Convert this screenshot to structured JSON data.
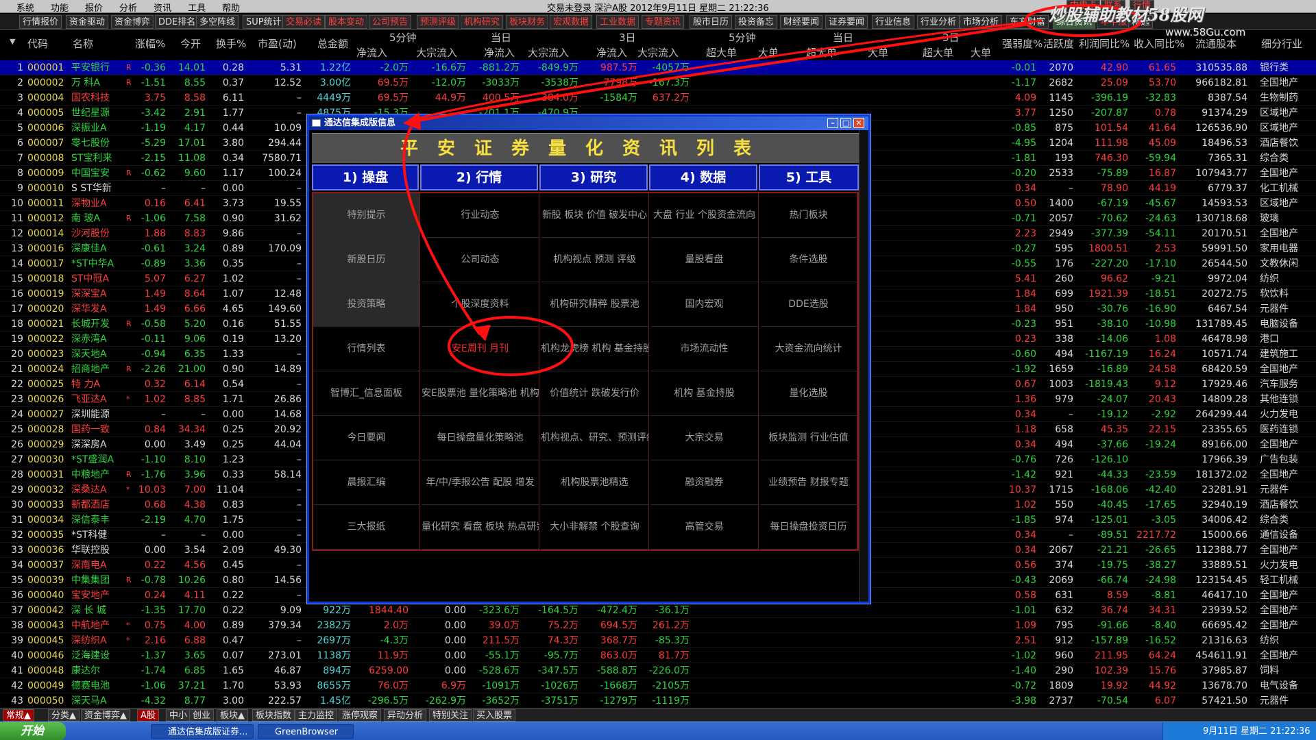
{
  "menu": {
    "items": [
      "系统",
      "功能",
      "报价",
      "分析",
      "资讯",
      "工具",
      "帮助"
    ],
    "status": "交易未登录    深沪A股    2012年9月11日  星期二  21:22:36",
    "right_buttons": [
      "内电卡",
      "联系",
      "行情"
    ]
  },
  "watermark": {
    "title": "炒股辅助教材58股网",
    "url": "www.58Gu.com"
  },
  "top_tabs": [
    {
      "label": "行情报价",
      "tone": "white"
    },
    {
      "label": "资金驱动",
      "tone": "white"
    },
    {
      "label": "资金博弈",
      "tone": "white"
    },
    {
      "label": "DDE排名",
      "tone": "white"
    },
    {
      "label": "多空阵线",
      "tone": "white"
    },
    {
      "label": "SUP统计",
      "tone": "white"
    },
    {
      "label": "交易必读",
      "tone": "red"
    },
    {
      "label": "股本变动",
      "tone": "red"
    },
    {
      "label": "公司预告",
      "tone": "red"
    },
    {
      "label": "预测评级",
      "tone": "red"
    },
    {
      "label": "机构研究",
      "tone": "red"
    },
    {
      "label": "板块财务",
      "tone": "red"
    },
    {
      "label": "宏观数据",
      "tone": "red"
    },
    {
      "label": "工业数据",
      "tone": "red"
    },
    {
      "label": "专题资讯",
      "tone": "red"
    },
    {
      "label": "股市日历",
      "tone": "white"
    },
    {
      "label": "投资备忘",
      "tone": "white"
    },
    {
      "label": "财经要闻",
      "tone": "white"
    },
    {
      "label": "证券要闻",
      "tone": "white"
    },
    {
      "label": "行业信息",
      "tone": "white"
    },
    {
      "label": "行业分析",
      "tone": "white"
    },
    {
      "label": "市场分析",
      "tone": "white"
    },
    {
      "label": "东方财富",
      "tone": "white"
    },
    {
      "label": "综合资讯",
      "tone": "active"
    },
    {
      "label": "年中报",
      "tone": "red"
    },
    {
      "label": "精选",
      "tone": "white"
    }
  ],
  "table": {
    "group_headers": [
      "5分钟",
      "当日",
      "3日",
      "5分钟",
      "当日",
      "3日"
    ],
    "headers": [
      "代码",
      "名称",
      "涨幅%",
      "今开",
      "换手%",
      "市盈(动)",
      "总金额",
      "净流入",
      "大宗流入",
      "净流入",
      "大宗流入",
      "净流入",
      "大宗流入",
      "超大单",
      "大单",
      "超大单",
      "大单",
      "超大单",
      "大单",
      "强弱度%",
      "活跃度",
      "利润同比%",
      "收入同比%",
      "流通股本",
      "细分行业"
    ],
    "rows": [
      [
        "1",
        "000001",
        "平安银行",
        "R",
        "-0.36",
        "14.01",
        "0.28",
        "5.31",
        "1.22亿",
        "-2.0万",
        "-16.6万",
        "-881.2万",
        "-849.9万",
        "987.5万",
        "-4057万",
        "-0.01",
        "2070",
        "42.90",
        "61.65",
        "310535.88",
        "银行类"
      ],
      [
        "2",
        "000002",
        "万  科A",
        "R",
        "-1.51",
        "8.55",
        "0.37",
        "12.52",
        "3.00亿",
        "69.5万",
        "-12.0万",
        "-3033万",
        "-3538万",
        "7798万",
        "-167.3万",
        "-1.17",
        "2682",
        "25.09",
        "53.70",
        "966182.81",
        "全国地产"
      ],
      [
        "3",
        "000004",
        "国农科技",
        "",
        "3.75",
        "8.58",
        "6.11",
        "–",
        "4449万",
        "69.5万",
        "44.9万",
        "400.5万",
        "384.0万",
        "-1584万",
        "637.2万",
        "4.09",
        "1145",
        "-396.19",
        "-32.83",
        "8387.54",
        "生物制药"
      ],
      [
        "4",
        "000005",
        "世纪星源",
        "",
        "-3.42",
        "2.91",
        "1.77",
        "–",
        "4875万",
        "-15.3万",
        "",
        "-201.1万",
        "-470.9万",
        "",
        "",
        "3.77",
        "1250",
        "-207.87",
        "0.78",
        "91374.29",
        "区域地产"
      ],
      [
        "5",
        "000006",
        "深振业A",
        "",
        "-1.19",
        "4.17",
        "0.44",
        "10.09",
        "",
        "",
        "",
        "",
        "",
        "",
        "",
        "-0.85",
        "875",
        "101.54",
        "41.64",
        "126536.90",
        "区域地产"
      ],
      [
        "6",
        "000007",
        "零七股份",
        "",
        "-5.29",
        "17.01",
        "3.80",
        "294.44",
        "",
        "",
        "",
        "",
        "",
        "",
        "",
        "-4.95",
        "1204",
        "111.98",
        "45.09",
        "18496.53",
        "酒店餐饮"
      ],
      [
        "7",
        "000008",
        "ST宝利来",
        "",
        "-2.15",
        "11.08",
        "0.34",
        "7580.71",
        "",
        "",
        "",
        "",
        "",
        "",
        "",
        "-1.81",
        "193",
        "746.30",
        "-59.94",
        "7365.31",
        "综合类"
      ],
      [
        "8",
        "000009",
        "中国宝安",
        "R",
        "-0.62",
        "9.60",
        "1.17",
        "100.24",
        "",
        "",
        "",
        "",
        "",
        "",
        "",
        "-0.20",
        "2533",
        "-75.89",
        "16.87",
        "107943.77",
        "全国地产"
      ],
      [
        "9",
        "000010",
        "S ST华新",
        "",
        "–",
        "–",
        "0.00",
        "–",
        "",
        "",
        "",
        "",
        "",
        "",
        "",
        "0.34",
        "–",
        "78.90",
        "44.19",
        "6779.37",
        "化工机械"
      ],
      [
        "10",
        "000011",
        "深物业A",
        "",
        "0.16",
        "6.41",
        "3.73",
        "19.55",
        "",
        "",
        "",
        "",
        "",
        "",
        "",
        "0.50",
        "1400",
        "-67.19",
        "-45.67",
        "14593.53",
        "区域地产"
      ],
      [
        "11",
        "000012",
        "南  玻A",
        "R",
        "-1.06",
        "7.58",
        "0.90",
        "31.62",
        "",
        "",
        "",
        "",
        "",
        "",
        "",
        "-0.71",
        "2057",
        "-70.62",
        "-24.63",
        "130718.68",
        "玻璃"
      ],
      [
        "12",
        "000014",
        "沙河股份",
        "",
        "1.88",
        "8.83",
        "9.86",
        "–",
        "",
        "",
        "",
        "",
        "",
        "",
        "",
        "2.23",
        "2949",
        "-377.39",
        "-54.11",
        "20170.51",
        "全国地产"
      ],
      [
        "13",
        "000016",
        "深康佳A",
        "",
        "-0.61",
        "3.24",
        "0.89",
        "170.09",
        "",
        "",
        "",
        "",
        "",
        "",
        "",
        "-0.27",
        "595",
        "1800.51",
        "2.53",
        "59991.50",
        "家用电器"
      ],
      [
        "14",
        "000017",
        "*ST中华A",
        "",
        "-0.89",
        "3.36",
        "0.35",
        "–",
        "",
        "",
        "",
        "",
        "",
        "",
        "",
        "-0.55",
        "176",
        "-227.20",
        "-17.10",
        "26544.50",
        "文教休闲"
      ],
      [
        "15",
        "000018",
        "ST中冠A",
        "",
        "5.07",
        "6.27",
        "1.02",
        "–",
        "",
        "",
        "",
        "",
        "",
        "",
        "",
        "5.41",
        "260",
        "96.62",
        "-9.21",
        "9972.04",
        "纺织"
      ],
      [
        "16",
        "000019",
        "深深宝A",
        "",
        "1.49",
        "8.64",
        "1.07",
        "12.48",
        "",
        "",
        "",
        "",
        "",
        "",
        "",
        "1.84",
        "699",
        "1921.39",
        "-18.51",
        "20272.75",
        "软饮料"
      ],
      [
        "17",
        "000020",
        "深华发A",
        "",
        "1.49",
        "6.66",
        "4.65",
        "149.60",
        "",
        "",
        "",
        "",
        "",
        "",
        "",
        "1.84",
        "950",
        "-30.76",
        "-16.90",
        "6467.54",
        "元器件"
      ],
      [
        "18",
        "000021",
        "长城开发",
        "R",
        "-0.58",
        "5.20",
        "0.16",
        "51.55",
        "",
        "",
        "",
        "",
        "",
        "",
        "",
        "-0.23",
        "951",
        "-38.10",
        "-10.98",
        "131789.45",
        "电脑设备"
      ],
      [
        "19",
        "000022",
        "深赤湾A",
        "",
        "-0.11",
        "9.06",
        "0.19",
        "13.20",
        "",
        "",
        "",
        "",
        "",
        "",
        "",
        "0.23",
        "338",
        "-14.06",
        "1.08",
        "46478.98",
        "港口"
      ],
      [
        "20",
        "000023",
        "深天地A",
        "",
        "-0.94",
        "6.35",
        "1.33",
        "–",
        "",
        "",
        "",
        "",
        "",
        "",
        "",
        "-0.60",
        "494",
        "-1167.19",
        "16.24",
        "10571.74",
        "建筑施工"
      ],
      [
        "21",
        "000024",
        "招商地产",
        "R",
        "-2.26",
        "21.00",
        "0.90",
        "14.89",
        "",
        "",
        "",
        "",
        "",
        "",
        "",
        "-1.92",
        "1659",
        "-16.89",
        "24.58",
        "68420.59",
        "全国地产"
      ],
      [
        "22",
        "000025",
        "特  力A",
        "",
        "0.32",
        "6.14",
        "0.54",
        "–",
        "",
        "",
        "",
        "",
        "",
        "",
        "",
        "0.67",
        "1003",
        "-1819.43",
        "9.12",
        "17929.46",
        "汽车服务"
      ],
      [
        "23",
        "000026",
        "飞亚达A",
        "*",
        "1.02",
        "8.85",
        "1.71",
        "26.86",
        "",
        "",
        "",
        "",
        "",
        "",
        "",
        "1.36",
        "979",
        "-24.07",
        "20.43",
        "14809.28",
        "其他连锁"
      ],
      [
        "24",
        "000027",
        "深圳能源",
        "",
        "–",
        "–",
        "0.00",
        "14.68",
        "",
        "",
        "",
        "",
        "",
        "",
        "",
        "0.34",
        "–",
        "-19.12",
        "-2.92",
        "264299.44",
        "火力发电"
      ],
      [
        "25",
        "000028",
        "国药一致",
        "",
        "0.84",
        "34.34",
        "0.25",
        "20.92",
        "",
        "",
        "",
        "",
        "",
        "",
        "",
        "1.18",
        "658",
        "45.35",
        "22.15",
        "23355.65",
        "医药连锁"
      ],
      [
        "26",
        "000029",
        "深深房A",
        "",
        "0.00",
        "3.49",
        "0.25",
        "44.04",
        "",
        "",
        "",
        "",
        "",
        "",
        "",
        "0.34",
        "494",
        "-37.66",
        "-19.24",
        "89166.00",
        "全国地产"
      ],
      [
        "27",
        "000030",
        "*ST盛润A",
        "",
        "-1.10",
        "8.10",
        "1.23",
        "–",
        "",
        "",
        "",
        "",
        "",
        "",
        "",
        "-0.76",
        "726",
        "-126.10",
        "",
        "17966.39",
        "广告包装"
      ],
      [
        "28",
        "000031",
        "中粮地产",
        "R",
        "-1.76",
        "3.96",
        "0.33",
        "58.14",
        "",
        "",
        "",
        "",
        "",
        "",
        "",
        "-1.42",
        "921",
        "-44.33",
        "-23.59",
        "181372.02",
        "全国地产"
      ],
      [
        "29",
        "000032",
        "深桑达A",
        "*",
        "10.03",
        "7.00",
        "11.04",
        "–",
        "",
        "",
        "",
        "",
        "",
        "",
        "",
        "10.37",
        "1715",
        "-168.06",
        "-42.40",
        "23281.91",
        "元器件"
      ],
      [
        "30",
        "000033",
        "新都酒店",
        "",
        "0.68",
        "4.38",
        "0.83",
        "–",
        "",
        "",
        "",
        "",
        "",
        "",
        "",
        "1.02",
        "550",
        "-40.45",
        "-17.65",
        "32940.19",
        "酒店餐饮"
      ],
      [
        "31",
        "000034",
        "深信泰丰",
        "",
        "-2.19",
        "4.70",
        "1.75",
        "–",
        "",
        "",
        "",
        "",
        "",
        "",
        "",
        "-1.85",
        "974",
        "-125.01",
        "-3.05",
        "34006.42",
        "综合类"
      ],
      [
        "32",
        "000035",
        "*ST科健",
        "",
        "–",
        "–",
        "0.00",
        "–",
        "",
        "",
        "",
        "",
        "",
        "",
        "",
        "0.34",
        "–",
        "-89.51",
        "2217.72",
        "15000.66",
        "通信设备"
      ],
      [
        "33",
        "000036",
        "华联控股",
        "",
        "0.00",
        "3.54",
        "2.09",
        "49.30",
        "",
        "",
        "",
        "",
        "",
        "",
        "",
        "0.34",
        "2067",
        "-21.21",
        "-26.65",
        "112388.77",
        "全国地产"
      ],
      [
        "34",
        "000037",
        "深南电A",
        "",
        "0.22",
        "4.56",
        "0.45",
        "–",
        "",
        "",
        "",
        "",
        "",
        "",
        "",
        "0.56",
        "374",
        "-19.75",
        "-38.27",
        "33889.51",
        "火力发电"
      ],
      [
        "35",
        "000039",
        "中集集团",
        "R",
        "-0.78",
        "10.26",
        "0.80",
        "14.56",
        "",
        "",
        "",
        "",
        "",
        "",
        "",
        "-0.43",
        "2069",
        "-66.74",
        "-24.98",
        "123154.45",
        "轻工机械"
      ],
      [
        "36",
        "000040",
        "宝安地产",
        "",
        "0.24",
        "4.11",
        "0.22",
        "–",
        "",
        "",
        "",
        "",
        "",
        "",
        "",
        "0.58",
        "631",
        "8.59",
        "-8.81",
        "46417.10",
        "全国地产"
      ],
      [
        "37",
        "000042",
        "深  长  城",
        "",
        "-1.35",
        "17.70",
        "0.22",
        "9.09",
        "922万",
        "1844.40",
        "0.00",
        "-323.6万",
        "-164.5万",
        "-472.4万",
        "-36.1万",
        "-1.01",
        "632",
        "36.74",
        "34.31",
        "23939.52",
        "全国地产"
      ],
      [
        "38",
        "000043",
        "中航地产",
        "*",
        "0.75",
        "4.00",
        "0.89",
        "379.34",
        "2382万",
        "2.0万",
        "0.00",
        "39.0万",
        "75.2万",
        "694.5万",
        "261.2万",
        "1.09",
        "795",
        "-91.66",
        "-8.40",
        "66695.42",
        "全国地产"
      ],
      [
        "39",
        "000045",
        "深纺织A",
        "*",
        "2.16",
        "6.88",
        "0.47",
        "–",
        "2697万",
        "-4.3万",
        "0.00",
        "211.5万",
        "74.3万",
        "368.7万",
        "-85.3万",
        "2.51",
        "912",
        "-157.89",
        "-16.52",
        "21316.63",
        "纺织"
      ],
      [
        "40",
        "000046",
        "泛海建设",
        "",
        "-1.37",
        "3.65",
        "0.07",
        "273.01",
        "1138万",
        "11.9万",
        "0.00",
        "-55.1万",
        "-95.7万",
        "863.0万",
        "81.7万",
        "-1.02",
        "960",
        "211.95",
        "64.24",
        "454611.91",
        "全国地产"
      ],
      [
        "41",
        "000048",
        "康达尔",
        "",
        "-1.74",
        "6.85",
        "1.65",
        "46.87",
        "894万",
        "6259.00",
        "0.00",
        "-528.6万",
        "-347.5万",
        "-588.8万",
        "-226.0万",
        "-1.40",
        "290",
        "102.39",
        "15.76",
        "37985.87",
        "饲料"
      ],
      [
        "42",
        "000049",
        "德赛电池",
        "",
        "-1.06",
        "37.21",
        "1.70",
        "53.93",
        "8655万",
        "76.0万",
        "6.9万",
        "-1091万",
        "-1026万",
        "-1668万",
        "-2105万",
        "-0.72",
        "1809",
        "19.92",
        "44.92",
        "13678.70",
        "电气设备"
      ],
      [
        "43",
        "000050",
        "深天马A",
        "",
        "-4.32",
        "8.77",
        "3.00",
        "222.57",
        "1.45亿",
        "-296.5万",
        "-262.9万",
        "-3652万",
        "-3751万",
        "-1279万",
        "-1119万",
        "-3.98",
        "2737",
        "-70.54",
        "6.07",
        "57421.50",
        "元器件"
      ]
    ]
  },
  "dialog": {
    "title": "通达信集成版信息",
    "banner": "平安证券量化资讯列表",
    "categories": [
      "1) 操盘",
      "2) 行情",
      "3) 研究",
      "4) 数据",
      "5) 工具"
    ],
    "grid": [
      [
        "特别提示",
        "行业动态",
        "新股  板块  价值  破发中心",
        "大盘  行业  个股资金流向",
        "热门板块"
      ],
      [
        "新股日历",
        "公司动态",
        "机构视点  预测  评级",
        "量股看盘",
        "条件选股"
      ],
      [
        "投资策略",
        "个股深度资料",
        "机构研究精粹  股票池",
        "国内宏观",
        "DDE选股"
      ],
      [
        "行情列表",
        "安E周刊  月刊",
        "机构龙虎榜  机构  基金持股",
        "市场流动性",
        "大资金流向统计"
      ],
      [
        "智博汇_信息面板",
        "安E股票池  量化策略池  机构精选",
        "价值统计  跌破发行价",
        "机构  基金持股",
        "量化选股"
      ],
      [
        "今日要闻",
        "每日操盘量化策略池",
        "机构视点、研究、预测评级",
        "大宗交易",
        "板块监测  行业估值"
      ],
      [
        "晨报汇编",
        "年/中/季报公告  配股  增发",
        "机构股票池精选",
        "融资融券",
        "业绩预告  财报专题"
      ],
      [
        "三大报纸",
        "量化研究  看盘  板块  热点研判",
        "大小非解禁  个股查询",
        "高管交易",
        "每日操盘投资日历"
      ]
    ]
  },
  "bottom_tabs": [
    "常规▲",
    "分类▲",
    "资金博弈▲",
    "A股",
    "中小",
    "创业",
    "板块▲",
    "板块指数",
    "主力监控",
    "涨停观察",
    "异动分析",
    "特别关注",
    "买入股票"
  ],
  "taskbar": {
    "start": "开始",
    "tasks": [
      "通达信集成版证券...",
      "GreenBrowser"
    ],
    "clock": "9月11日  星期二  21:22:36"
  },
  "colors": {
    "up": "#ff3c3c",
    "down": "#2cd63c",
    "selected_row": "#0000a0",
    "dialog_border": "#0a3ad0",
    "annotation": "#ff1010"
  }
}
